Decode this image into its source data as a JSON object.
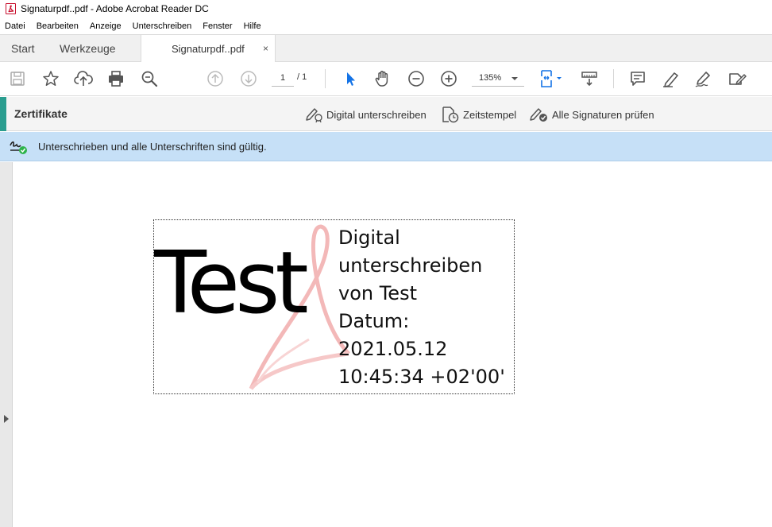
{
  "window": {
    "title": "Signaturpdf..pdf - Adobe Acrobat Reader DC"
  },
  "menu": [
    "Datei",
    "Bearbeiten",
    "Anzeige",
    "Unterschreiben",
    "Fenster",
    "Hilfe"
  ],
  "tabs": {
    "start": "Start",
    "tools": "Werkzeuge",
    "document": "Signaturpdf..pdf",
    "close": "×"
  },
  "toolbar": {
    "page_current": "1",
    "page_total": "/ 1",
    "zoom": "135%",
    "icons": [
      "save-icon",
      "bookmark-star-icon",
      "upload-cloud-icon",
      "print-icon",
      "search-zoom-icon",
      "page-up-icon",
      "page-down-icon",
      "select-arrow-icon",
      "hand-tool-icon",
      "zoom-out-icon",
      "zoom-in-icon",
      "fit-page-icon",
      "scroll-mode-icon",
      "comment-icon",
      "highlight-pen-icon",
      "sign-pen-icon",
      "fill-sign-icon"
    ]
  },
  "certificates": {
    "title": "Zertifikate",
    "digital_sign": "Digital unterschreiben",
    "timestamp": "Zeitstempel",
    "validate_all": "Alle Signaturen prüfen"
  },
  "signature_status": {
    "text": "Unterschrieben und alle Unterschriften sind gültig."
  },
  "signature_field": {
    "name": "Test",
    "lines": [
      "Digital",
      "unterschreiben",
      "von Test",
      "Datum:",
      "2021.05.12",
      "10:45:34 +02'00'"
    ]
  },
  "colors": {
    "accent_teal": "#2a9d8f",
    "status_bar": "#c6e0f7",
    "icon_blue": "#1473e6",
    "watermark": "#f3b8b8"
  }
}
